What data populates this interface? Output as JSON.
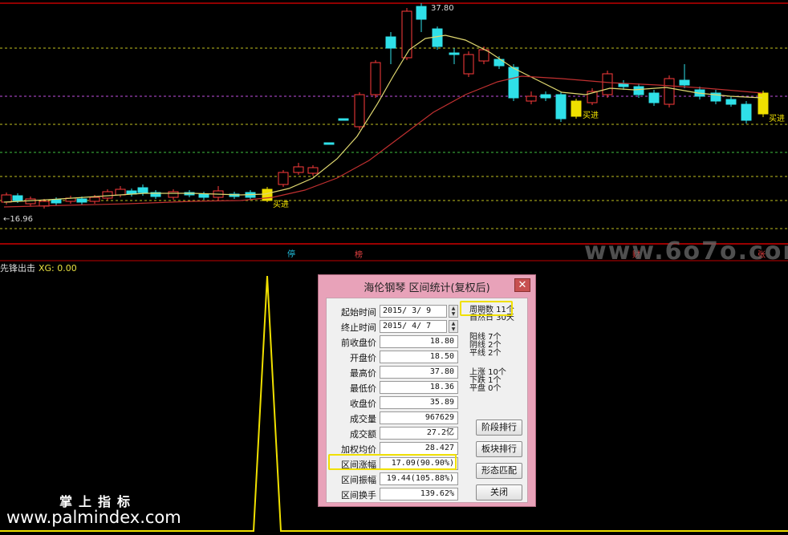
{
  "price_chart": {
    "high_label": "37.80",
    "low_label": "←16.96",
    "buy_signals": [
      "买进",
      "买进",
      "买进"
    ],
    "markers": [
      {
        "text": "停",
        "color": "#22c8e8"
      },
      {
        "text": "榜",
        "color": "#e04040"
      },
      {
        "text": "财",
        "color": "#e04040"
      },
      {
        "text": "张",
        "color": "#e04040"
      }
    ],
    "watermark": "www.6o7o.com",
    "colors": {
      "up": "#ff3b3b",
      "down": "#2fe0e8",
      "buy": "#f0e000",
      "ma_short": "#e0d870",
      "ma_long": "#c03030",
      "grid": "#c0c020",
      "purple_line": "#c050e0"
    }
  },
  "indicator": {
    "name": "先锋出击",
    "xg_label": "XG: 0.00",
    "color": "#f0e000"
  },
  "dialog": {
    "title": "海伦钢琴 区间统计(复权后)",
    "close_glyph": "✕",
    "start_label": "起始时间",
    "start_value": "2015/ 3/ 9",
    "end_label": "终止时间",
    "end_value": "2015/ 4/ 7",
    "rows": [
      {
        "label": "前收盘价",
        "value": "18.80"
      },
      {
        "label": "开盘价",
        "value": "18.50"
      },
      {
        "label": "最高价",
        "value": "37.80"
      },
      {
        "label": "最低价",
        "value": "18.36"
      },
      {
        "label": "收盘价",
        "value": "35.89"
      },
      {
        "label": "成交量",
        "value": "967629"
      },
      {
        "label": "成交额",
        "value": "27.2亿"
      },
      {
        "label": "加权均价",
        "value": "28.427"
      },
      {
        "label": "区间涨幅",
        "value": "17.09(90.90%)"
      },
      {
        "label": "区间振幅",
        "value": "19.44(105.88%)"
      },
      {
        "label": "区间换手",
        "value": "139.62%"
      }
    ],
    "period_count": "周期数 11个",
    "natural_days": "自然日 30天",
    "yang": "阳线 7个",
    "yin": "阴线 2个",
    "flat_line": "平线 2个",
    "up": "上涨 10个",
    "down": "下跌 1个",
    "flat": "平盘 0个",
    "buttons": [
      "阶段排行",
      "板块排行",
      "形态匹配",
      "关闭"
    ]
  },
  "site": {
    "name_cn": "掌上指标",
    "url": "www.palmindex.com"
  }
}
